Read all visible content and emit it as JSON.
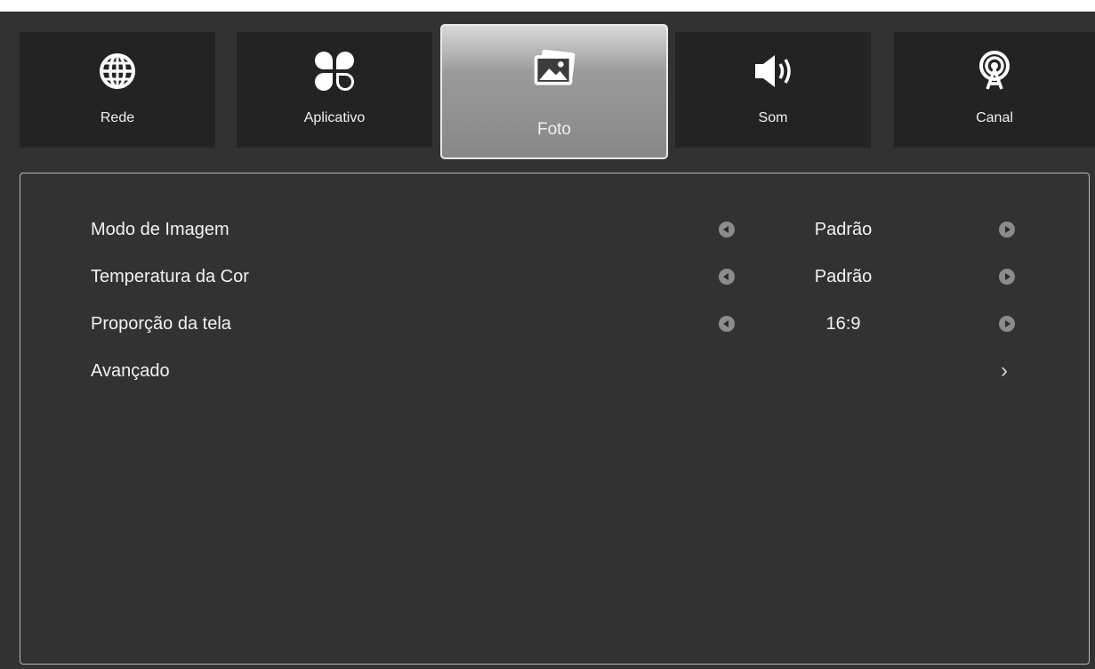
{
  "tabs": [
    {
      "label": "Rede",
      "icon": "globe-icon"
    },
    {
      "label": "Aplicativo",
      "icon": "apps-icon"
    },
    {
      "label": "Foto",
      "icon": "photo-icon",
      "active": true
    },
    {
      "label": "Som",
      "icon": "speaker-icon"
    },
    {
      "label": "Canal",
      "icon": "antenna-icon"
    }
  ],
  "settings": [
    {
      "label": "Modo de Imagem",
      "value": "Padrão"
    },
    {
      "label": "Temperatura da Cor",
      "value": "Padrão"
    },
    {
      "label": "Proporção da tela",
      "value": "16:9"
    },
    {
      "label": "Avançado",
      "value": "",
      "submenu_glyph": "›"
    }
  ],
  "colors": {
    "background": "#323232",
    "tab_background": "#232323",
    "active_tab_top": "#d9d9d9",
    "active_tab_bottom": "#878787",
    "text": "#f2f2f2",
    "arrow_button": "#8c8c8c",
    "panel_border": "#b8b8b8"
  }
}
